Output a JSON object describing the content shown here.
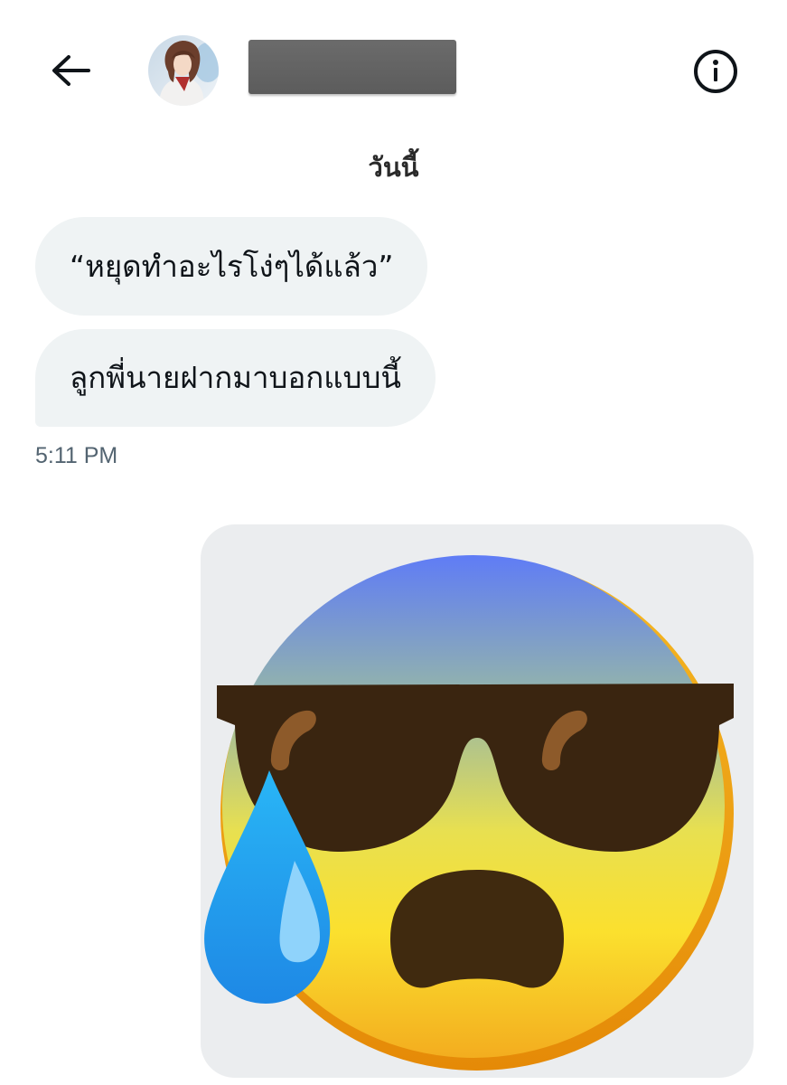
{
  "header": {
    "back_icon": "arrow-left-icon",
    "avatar_icon": "profile-avatar",
    "name_redacted": true,
    "info_icon": "info-circle-icon"
  },
  "conversation": {
    "date_label": "วันนี้",
    "messages": [
      {
        "text": "“หยุดทำอะไรโง่ๆได้แล้ว”"
      },
      {
        "text": "ลูกพี่นายฝากมาบอกแบบนี้"
      }
    ],
    "timestamp": "5:11 PM",
    "sent_media": {
      "type": "emoji-sticker",
      "icon": "cool-anxious-sweat-emoji"
    }
  },
  "colors": {
    "bubble_bg": "#eff3f4",
    "timestamp": "#536471",
    "media_bg": "#ebedef"
  }
}
